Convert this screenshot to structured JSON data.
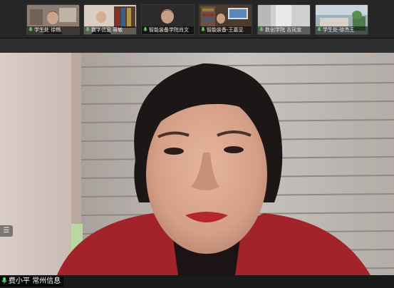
{
  "thumbnails": [
    {
      "label": "学生处 徐畅"
    },
    {
      "label": "数字信息 蒋敏"
    },
    {
      "label": "智能装备学院肖文"
    },
    {
      "label": "智能装备-王嘉显"
    },
    {
      "label": "数创学院 吉凤宣"
    },
    {
      "label": "学生处-徐杰王"
    }
  ],
  "main_speaker": {
    "name": "费小平",
    "org": "常州信息"
  },
  "side_handle_icon": "list-icon",
  "colors": {
    "background": "#1f1f1f",
    "mic_green": "#5fd35f"
  }
}
